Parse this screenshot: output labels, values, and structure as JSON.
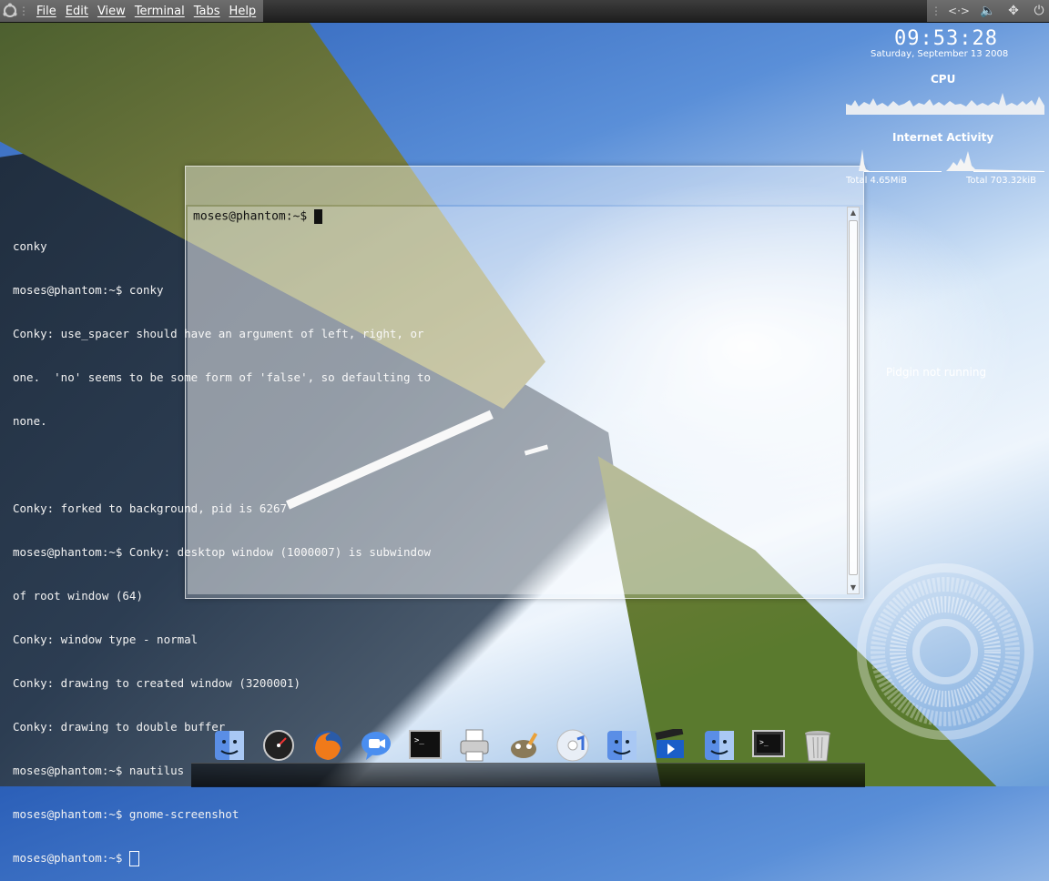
{
  "top_panel": {
    "app_icon": "ubuntu-logo-icon",
    "menu": [
      "File",
      "Edit",
      "View",
      "Terminal",
      "Tabs",
      "Help"
    ],
    "tray_icons": [
      "network-icon",
      "volume-icon",
      "network-manager-icon",
      "power-icon"
    ]
  },
  "background_terminal": {
    "lines": [
      "conky",
      "moses@phantom:~$ conky",
      "Conky: use_spacer should have an argument of left, right, or",
      "one.  'no' seems to be some form of 'false', so defaulting to",
      "none.",
      "",
      "Conky: forked to background, pid is 6267",
      "moses@phantom:~$ Conky: desktop window (1000007) is subwindow",
      "of root window (64)",
      "Conky: window type - normal",
      "Conky: drawing to created window (3200001)",
      "Conky: drawing to double buffer",
      "moses@phantom:~$ nautilus",
      "moses@phantom:~$ gnome-screenshot",
      "moses@phantom:~$ "
    ]
  },
  "terminal_window": {
    "prompt": "moses@phantom:~$ "
  },
  "conky": {
    "time": "09:53:28",
    "date": "Saturday, September 13 2008",
    "cpu_label": "CPU",
    "internet_label": "Internet Activity",
    "total_down": "Total 4.65MiB",
    "total_up": "Total 703.32kiB",
    "pidgin_status": "Pidgin not running"
  },
  "dock": {
    "items": [
      "finder-icon",
      "dashboard-icon",
      "firefox-icon",
      "ichat-icon",
      "terminal-icon",
      "printer-icon",
      "gimp-icon",
      "itunes-icon",
      "finder-icon",
      "video-clapper-icon",
      "finder-icon",
      "terminal-icon",
      "trash-icon"
    ]
  }
}
